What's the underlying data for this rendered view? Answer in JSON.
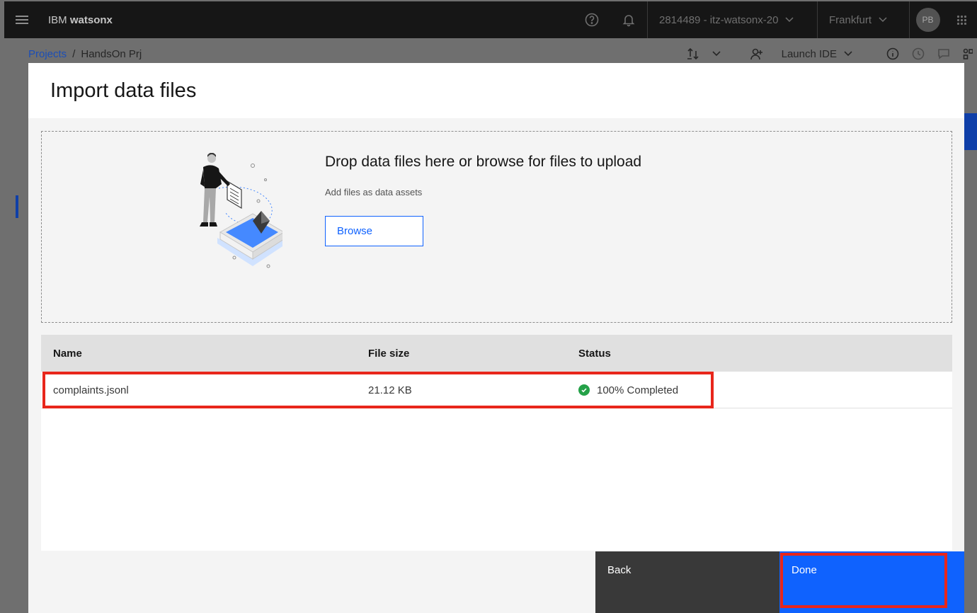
{
  "header": {
    "brand_prefix": "IBM",
    "brand_name": "watsonx",
    "account": "2814489 - itz-watsonx-20",
    "region": "Frankfurt",
    "avatar_initials": "PB"
  },
  "breadcrumb": {
    "parent": "Projects",
    "separator": "/",
    "current": "HandsOn Prj"
  },
  "toolbar": {
    "launch_ide_label": "Launch IDE"
  },
  "modal": {
    "title": "Import data files",
    "dropzone": {
      "title": "Drop data files here or browse for files to upload",
      "subtitle": "Add files as data assets",
      "browse_label": "Browse"
    },
    "table": {
      "columns": [
        "Name",
        "File size",
        "Status"
      ],
      "rows": [
        {
          "name": "complaints.jsonl",
          "size": "21.12 KB",
          "status": "100% Completed"
        }
      ]
    },
    "footer": {
      "back_label": "Back",
      "done_label": "Done"
    }
  },
  "colors": {
    "primary": "#0f62fe",
    "success": "#24a148",
    "highlight": "#e8261b",
    "header_bg": "#161616"
  }
}
